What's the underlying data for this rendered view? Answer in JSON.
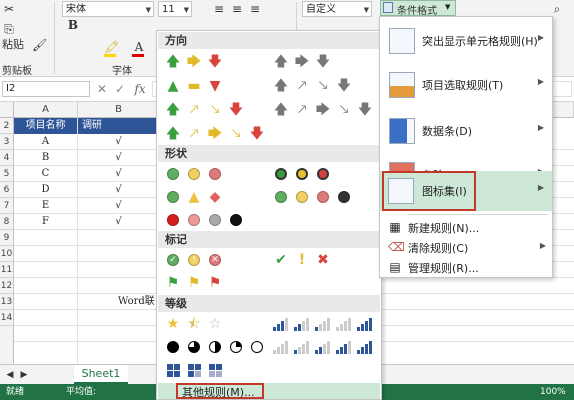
{
  "ribbon": {
    "paste_label": "粘贴",
    "clipboard_label": "剪贴板",
    "font_group_label": "字体",
    "font_name": "宋体",
    "font_size": "11",
    "number_format": "自定义",
    "cond_format_label": "条件格式"
  },
  "formula_bar": {
    "name_box": "I2"
  },
  "grid": {
    "columns": [
      "A",
      "B"
    ],
    "rows": [
      "2",
      "3",
      "4",
      "5",
      "6",
      "7",
      "8",
      "9",
      "10",
      "11",
      "12",
      "13",
      "14"
    ],
    "header_row": [
      "项目名称",
      "调研"
    ],
    "data_rows": [
      [
        "A",
        "√"
      ],
      [
        "B",
        "√"
      ],
      [
        "C",
        "√"
      ],
      [
        "D",
        "√"
      ],
      [
        "E",
        "√"
      ],
      [
        "F",
        "√"
      ]
    ],
    "truncated_text": "Word联"
  },
  "sheet_tab": "Sheet1",
  "status": {
    "left": "就绪",
    "avg_label": "平均值: ",
    "zoom": "100%"
  },
  "icon_sets": {
    "sections": {
      "direction": "方向",
      "shape": "形状",
      "indicator": "标记",
      "rating": "等级"
    },
    "more_rules": "其他规则(M)..."
  },
  "cf_menu": {
    "items": [
      {
        "label": "突出显示单元格规则(H)"
      },
      {
        "label": "项目选取规则(T)"
      },
      {
        "label": "数据条(D)"
      },
      {
        "label": "色阶(S)"
      },
      {
        "label": "图标集(I)"
      }
    ],
    "small_items": [
      {
        "label": "新建规则(N)..."
      },
      {
        "label": "清除规则(C)"
      },
      {
        "label": "管理规则(R)..."
      }
    ]
  },
  "colors": {
    "accent_green": "#217346",
    "highlight_red": "#c0392b",
    "selection_blue": "#2d5597",
    "hover_green": "#cde8d6"
  }
}
